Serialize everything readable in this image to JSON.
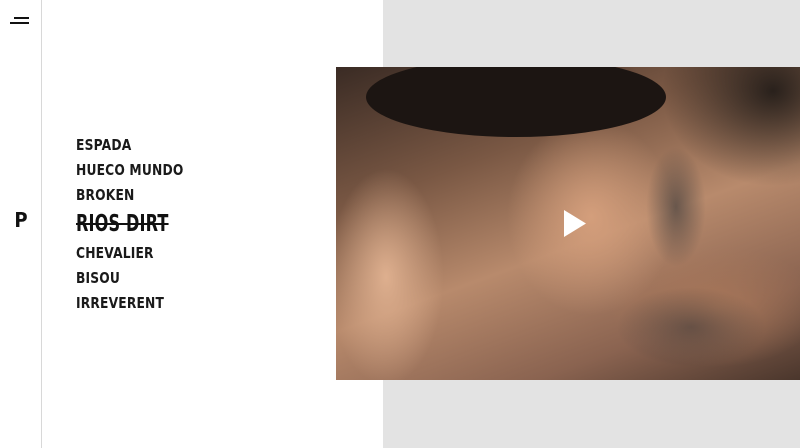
{
  "nav": {
    "menu_icon": "hamburger-menu-icon",
    "logo": "P"
  },
  "tracks": [
    {
      "label": "ESPADA",
      "active": false
    },
    {
      "label": "HUECO MUNDO",
      "active": false
    },
    {
      "label": "BROKEN",
      "active": false
    },
    {
      "label": "RIOS DIRT",
      "active": true
    },
    {
      "label": "CHEVALIER",
      "active": false
    },
    {
      "label": "BISOU",
      "active": false
    },
    {
      "label": "IRREVERENT",
      "active": false
    }
  ],
  "video": {
    "play_icon": "play-icon"
  },
  "colors": {
    "panel_background": "#e3e3e3",
    "text": "#1a1a1a",
    "page_background": "#ffffff"
  }
}
